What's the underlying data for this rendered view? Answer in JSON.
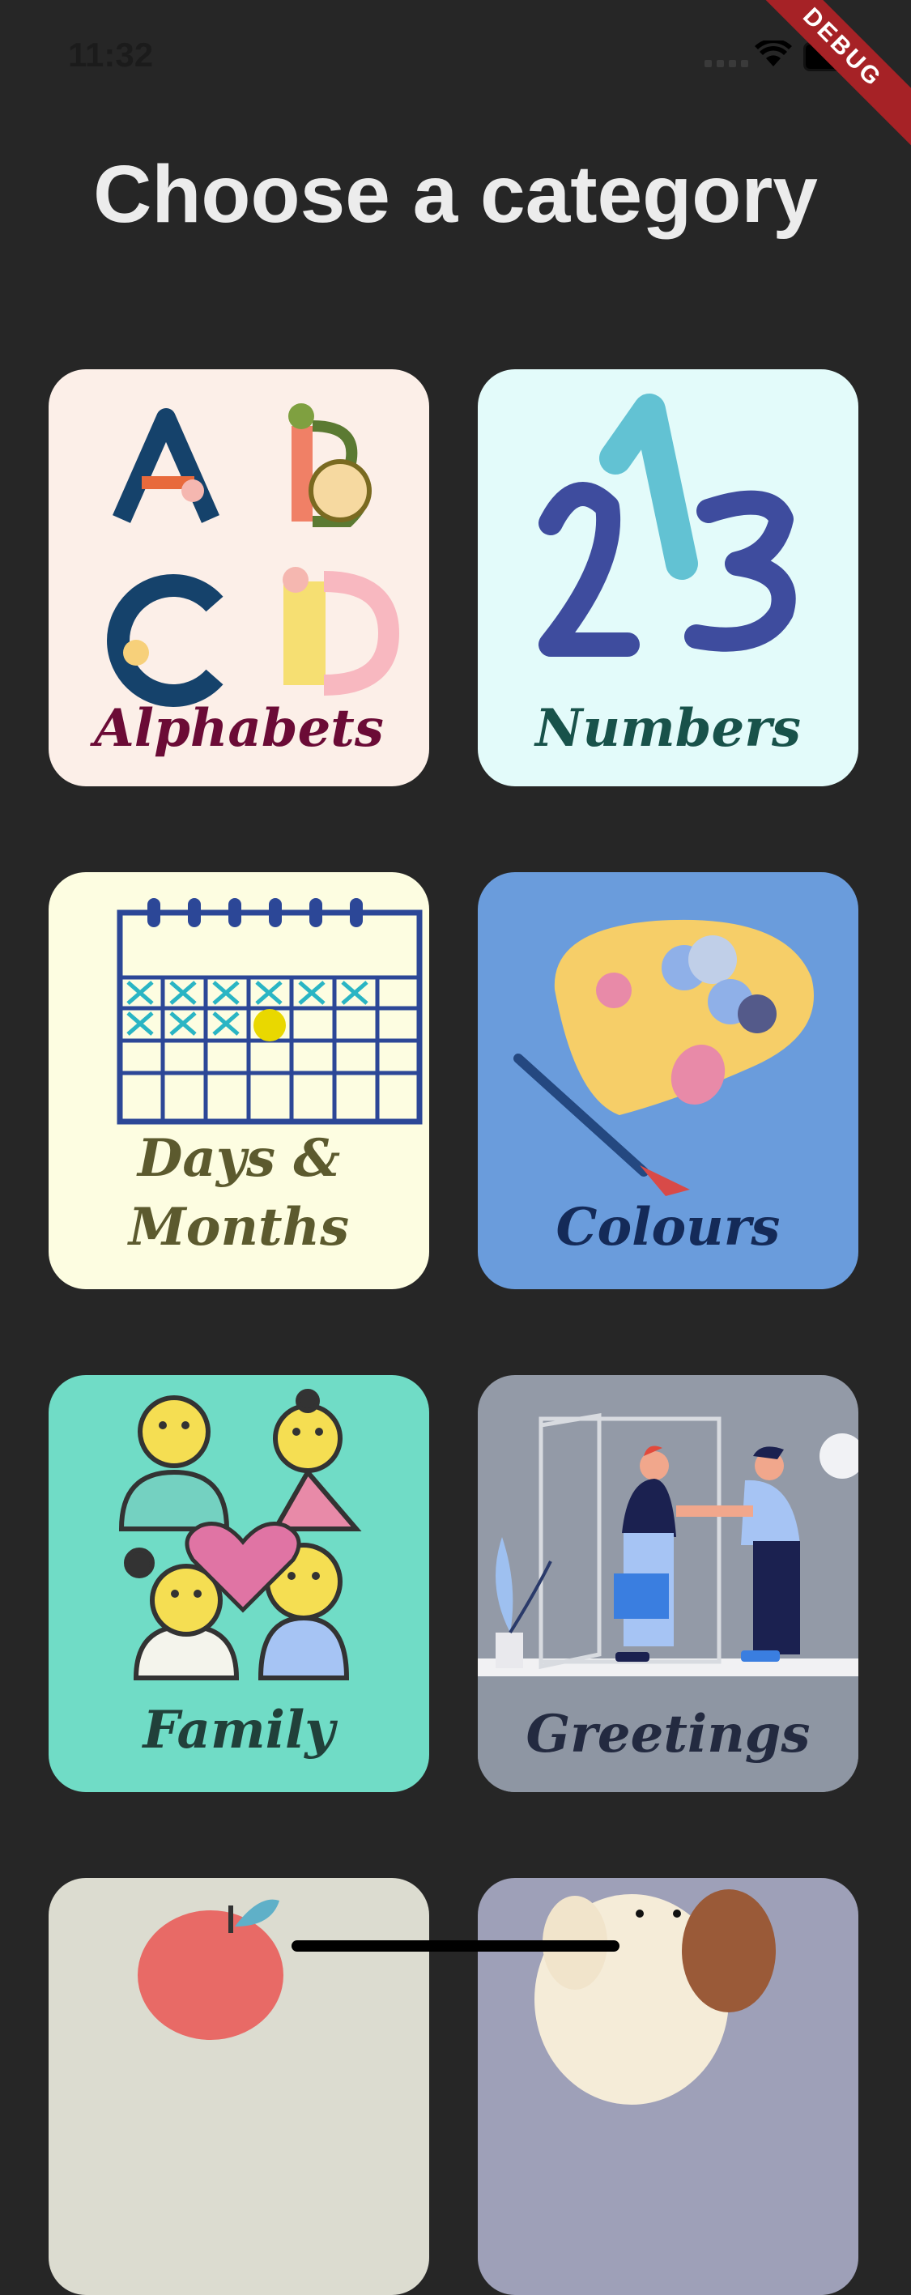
{
  "status_bar": {
    "time": "11:32",
    "debug_banner": "DEBUG"
  },
  "header": {
    "title": "Choose a category"
  },
  "categories": [
    {
      "label": "Alphabets",
      "label_color": "#6b0b36",
      "bg": "#fcefe8",
      "icon": "alphabet-blocks-illustration"
    },
    {
      "label": "Numbers",
      "label_color": "#18524a",
      "bg": "#e3fbfa",
      "icon": "numbers-123-illustration"
    },
    {
      "label": "Days &",
      "label2": "Months",
      "label_color": "#5c5a2e",
      "bg": "#fdfde1",
      "icon": "calendar-illustration"
    },
    {
      "label": "Colours",
      "label_color": "#142a58",
      "bg": "#6a9cdc",
      "icon": "paint-palette-illustration"
    },
    {
      "label": "Family",
      "label_color": "#21403a",
      "bg": "#70dcc6",
      "icon": "family-faces-illustration"
    },
    {
      "label": "Greetings",
      "label_color": "#232a40",
      "bg": "#939aa7",
      "icon": "handshake-greeting-illustration"
    },
    {
      "label": "",
      "bg": "#dcdcd0",
      "icon": "apple-illustration"
    },
    {
      "label": "",
      "bg": "#9ea0b8",
      "icon": "puppy-illustration"
    }
  ]
}
